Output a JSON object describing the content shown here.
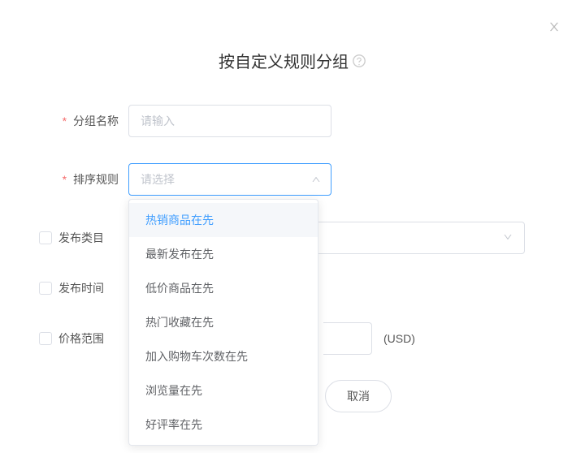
{
  "title": "按自定义规则分组",
  "fields": {
    "group_name": {
      "label": "分组名称",
      "placeholder": "请输入"
    },
    "sort_rule": {
      "label": "排序规则",
      "placeholder": "请选择",
      "options": [
        "热销商品在先",
        "最新发布在先",
        "低价商品在先",
        "热门收藏在先",
        "加入购物车次数在先",
        "浏览量在先",
        "好评率在先"
      ]
    },
    "publish_category": {
      "label": "发布类目"
    },
    "publish_time": {
      "label": "发布时间"
    },
    "price_range": {
      "label": "价格范围"
    }
  },
  "currency": "(USD)",
  "buttons": {
    "cancel": "取消"
  }
}
